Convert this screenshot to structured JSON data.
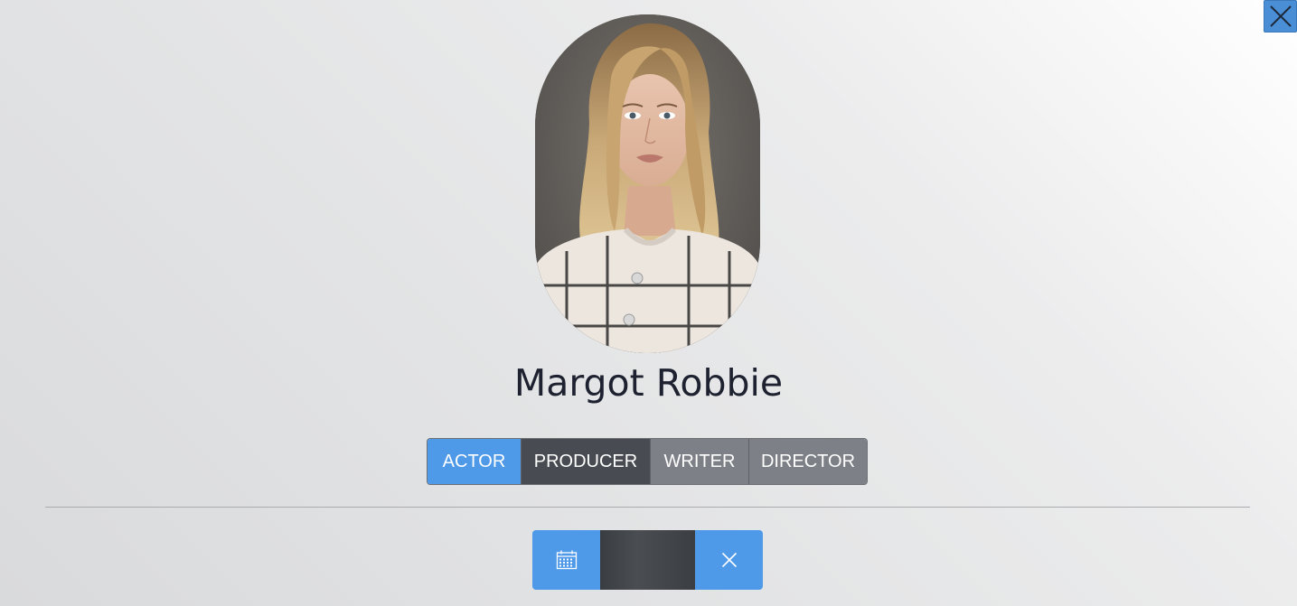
{
  "person": {
    "name": "Margot Robbie"
  },
  "roles": [
    {
      "label": "ACTOR",
      "active": true
    },
    {
      "label": "PRODUCER",
      "active": false
    },
    {
      "label": "WRITER",
      "active": false
    },
    {
      "label": "DIRECTOR",
      "active": false
    }
  ],
  "icons": {
    "close": "close-icon",
    "calendar": "calendar-icon",
    "clear": "close-icon"
  },
  "colors": {
    "accent": "#4e99e8",
    "dark": "#484c52",
    "muted": "#7d8086",
    "text": "#1e2230"
  }
}
